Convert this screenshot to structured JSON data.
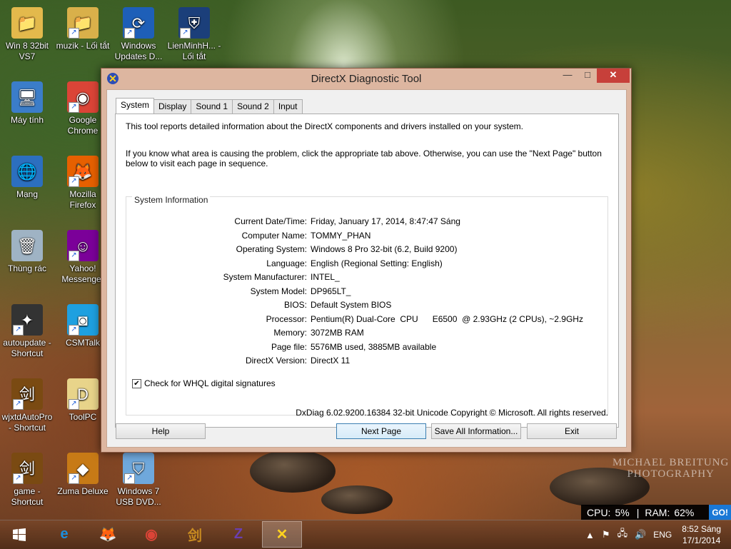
{
  "desktop_icons": [
    {
      "label": "Win 8 32bit VS7",
      "icon": "folder-user-icon",
      "shortcut": false
    },
    {
      "label": "muzik - Lối tắt",
      "icon": "folder-media-icon",
      "shortcut": true
    },
    {
      "label": "Windows Updates D...",
      "icon": "windows-update-icon",
      "shortcut": true
    },
    {
      "label": "LienMinhH... - Lối tắt",
      "icon": "game-shield-icon",
      "shortcut": true
    },
    {
      "label": "Máy tính",
      "icon": "computer-icon",
      "shortcut": false
    },
    {
      "label": "Google Chrome",
      "icon": "chrome-icon",
      "shortcut": true
    },
    {
      "label": "Mạng",
      "icon": "network-icon",
      "shortcut": false
    },
    {
      "label": "Mozilla Firefox",
      "icon": "firefox-icon",
      "shortcut": true
    },
    {
      "label": "Thùng rác",
      "icon": "recycle-bin-icon",
      "shortcut": false
    },
    {
      "label": "Yahoo! Messenger",
      "icon": "yahoo-messenger-icon",
      "shortcut": true
    },
    {
      "label": "autoupdate - Shortcut",
      "icon": "autoupdate-icon",
      "shortcut": true
    },
    {
      "label": "CSMTalk",
      "icon": "csmtalk-icon",
      "shortcut": true
    },
    {
      "label": "wjxtdAutoPro - Shortcut",
      "icon": "jianxia-icon",
      "shortcut": true
    },
    {
      "label": "ToolPC",
      "icon": "toolpc-icon",
      "shortcut": true
    },
    {
      "label": "game - Shortcut",
      "icon": "jianxia-icon",
      "shortcut": true
    },
    {
      "label": "Zuma Deluxe",
      "icon": "zuma-icon",
      "shortcut": true
    },
    {
      "label": "Windows 7 USB DVD...",
      "icon": "usb-dvd-tool-icon",
      "shortcut": true
    }
  ],
  "watermark": {
    "line1": "MICHAEL BREITUNG",
    "line2": "PHOTOGRAPHY"
  },
  "cpu_ram": {
    "cpu_label": "CPU:",
    "cpu_value": "5%",
    "ram_label": "RAM:",
    "ram_value": "62%",
    "go": "GO!"
  },
  "window": {
    "title": "DirectX Diagnostic Tool",
    "tabs": [
      "System",
      "Display",
      "Sound 1",
      "Sound 2",
      "Input"
    ],
    "selected_tab": "System",
    "intro1": "This tool reports detailed information about the DirectX components and drivers installed on your system.",
    "intro2": "If you know what area is causing the problem, click the appropriate tab above.  Otherwise, you can use the \"Next Page\" button below to visit each page in sequence.",
    "group_title": "System Information",
    "info": [
      {
        "label": "Current Date/Time:",
        "value": "Friday, January 17, 2014, 8:47:47 Sáng"
      },
      {
        "label": "Computer Name:",
        "value": "TOMMY_PHAN"
      },
      {
        "label": "Operating System:",
        "value": "Windows 8 Pro 32-bit (6.2, Build 9200)"
      },
      {
        "label": "Language:",
        "value": "English (Regional Setting: English)"
      },
      {
        "label": "System Manufacturer:",
        "value": "INTEL_"
      },
      {
        "label": "System Model:",
        "value": "DP965LT_"
      },
      {
        "label": "BIOS:",
        "value": "Default System BIOS"
      },
      {
        "label": "Processor:",
        "value": "Pentium(R) Dual-Core  CPU      E6500  @ 2.93GHz (2 CPUs), ~2.9GHz"
      },
      {
        "label": "Memory:",
        "value": "3072MB RAM"
      },
      {
        "label": "Page file:",
        "value": "5576MB used, 3885MB available"
      },
      {
        "label": "DirectX Version:",
        "value": "DirectX 11"
      }
    ],
    "whql_label": "Check for WHQL digital signatures",
    "whql_checked": true,
    "footer": "DxDiag 6.02.9200.16384 32-bit Unicode  Copyright © Microsoft. All rights reserved.",
    "buttons": {
      "help": "Help",
      "next": "Next Page",
      "save": "Save All Information...",
      "exit": "Exit"
    }
  },
  "taskbar": {
    "apps": [
      "internet-explorer-icon",
      "firefox-icon",
      "chrome-icon",
      "jianxia-icon",
      "cpu-z-icon",
      "directx-icon"
    ],
    "active_app": "directx-icon",
    "language": "ENG",
    "time": "8:52 Sáng",
    "date": "17/1/2014"
  }
}
